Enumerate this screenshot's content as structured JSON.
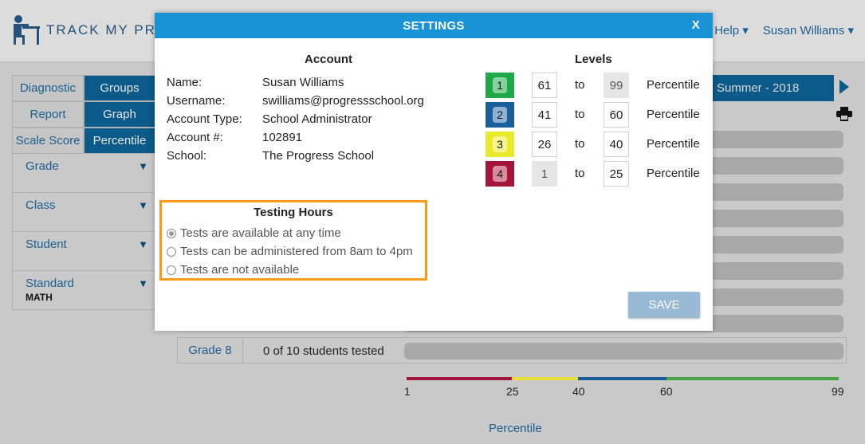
{
  "app": {
    "logo_text": "TRACK MY PRO",
    "nav": {
      "help": "Help ▾",
      "user": "Susan Williams ▾"
    }
  },
  "sidebar": {
    "toggles": [
      {
        "left": "Diagnostic",
        "right": "Groups"
      },
      {
        "left": "Report",
        "right": "Graph"
      },
      {
        "left": "Scale Score",
        "right": "Percentile"
      }
    ],
    "filters": [
      {
        "label": "Grade",
        "value": ""
      },
      {
        "label": "Class",
        "value": ""
      },
      {
        "label": "Student",
        "value": ""
      },
      {
        "label": "Standard",
        "value": "MATH"
      }
    ],
    "arrow": "▼"
  },
  "season": {
    "label": "Summer - 2018"
  },
  "report": {
    "grade_row": {
      "label": "Grade 8",
      "status": "0 of 10 students tested"
    },
    "scale_ticks": [
      "1",
      "25",
      "40",
      "60",
      "99"
    ],
    "scale_title": "Percentile",
    "colors": {
      "red": "#a3153b",
      "yellow": "#e7e03a",
      "blue": "#1a5f9b",
      "green": "#4ba544"
    }
  },
  "modal": {
    "title": "SETTINGS",
    "close": "X",
    "account": {
      "title": "Account",
      "rows": [
        {
          "key": "Name:",
          "value": "Susan Williams"
        },
        {
          "key": "Username:",
          "value": "swilliams@progressschool.org"
        },
        {
          "key": "Account Type:",
          "value": "School Administrator"
        },
        {
          "key": "Account #:",
          "value": "102891"
        },
        {
          "key": "School:",
          "value": "The Progress School"
        }
      ]
    },
    "levels": {
      "title": "Levels",
      "to_label": "to",
      "unit": "Percentile",
      "rows": [
        {
          "level": "1",
          "from": "61",
          "to": "99",
          "badge_bg": "#1fa84a",
          "badge_fg": "#86d29b"
        },
        {
          "level": "2",
          "from": "41",
          "to": "60",
          "badge_bg": "#1a5f9b",
          "badge_fg": "#8fb1d2"
        },
        {
          "level": "3",
          "from": "26",
          "to": "40",
          "badge_bg": "#eaea2c",
          "badge_fg": "#f6f48e"
        },
        {
          "level": "4",
          "from": "1",
          "to": "25",
          "badge_bg": "#a3153b",
          "badge_fg": "#d98a9b"
        }
      ]
    },
    "testing_hours": {
      "title": "Testing Hours",
      "options": [
        {
          "label": "Tests are available at any time",
          "checked": true
        },
        {
          "label": "Tests can be administered from 8am to 4pm",
          "checked": false
        },
        {
          "label": "Tests are not available",
          "checked": false
        }
      ],
      "highlight_color": "#f59c1a"
    },
    "save_label": "SAVE"
  }
}
